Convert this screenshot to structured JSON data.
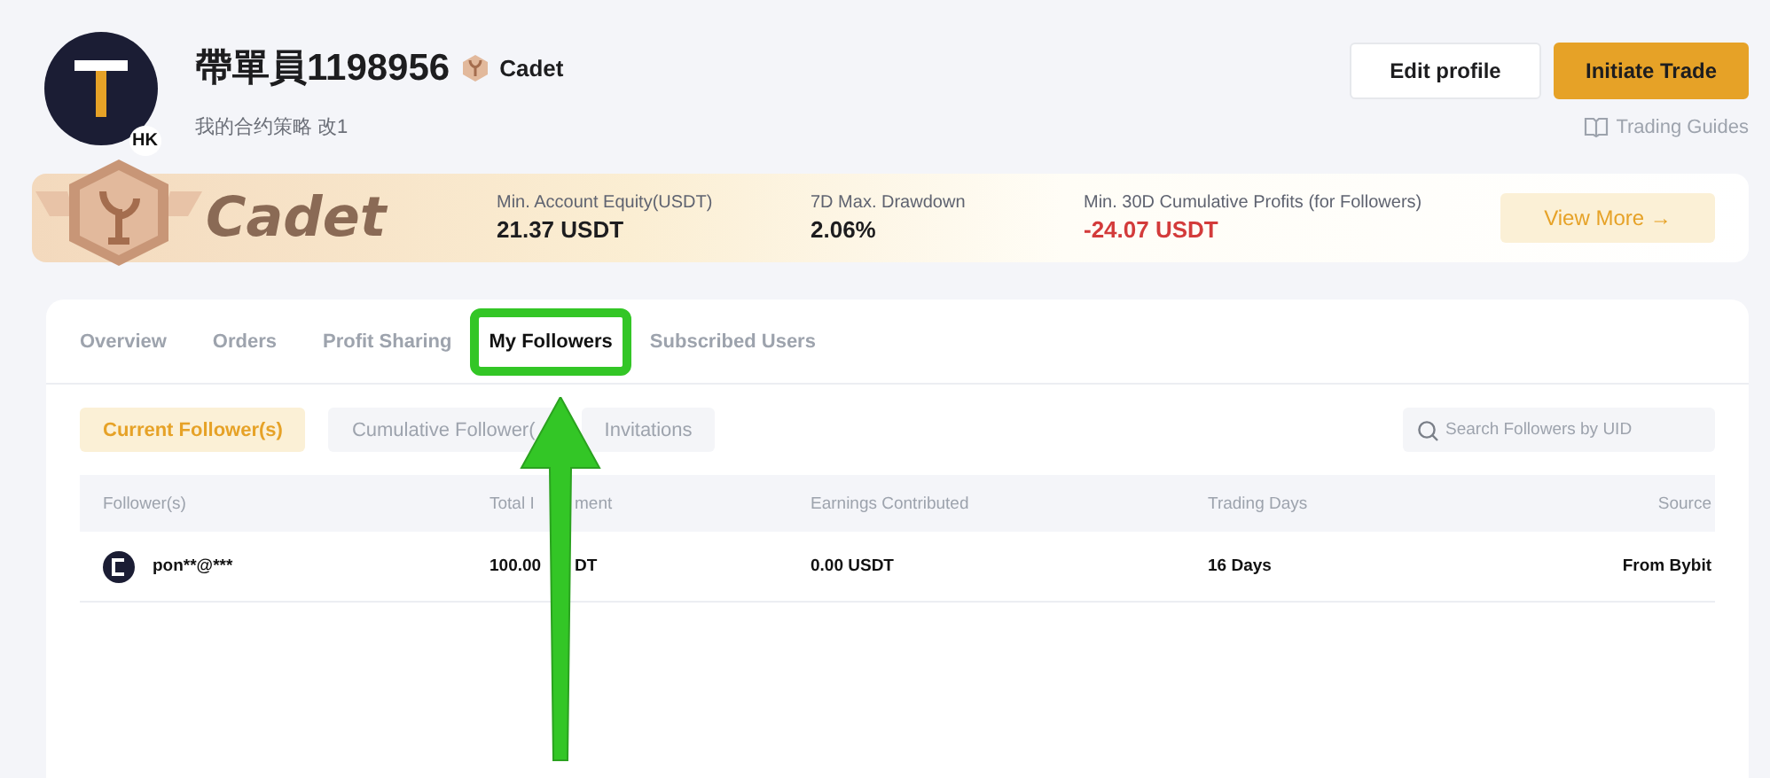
{
  "profile": {
    "avatar_badge": "HK",
    "name": "帶單員1198956",
    "level_badge": "Cadet",
    "bio": "我的合约策略 改1"
  },
  "actions": {
    "edit": "Edit profile",
    "trade": "Initiate Trade",
    "guides": "Trading Guides"
  },
  "banner": {
    "level": "Cadet",
    "stats": [
      {
        "label": "Min. Account Equity(USDT)",
        "value": "21.37 USDT",
        "negative": false
      },
      {
        "label": "7D Max. Drawdown",
        "value": "2.06%",
        "negative": false
      },
      {
        "label": "Min. 30D Cumulative Profits (for Followers)",
        "value": "-24.07 USDT",
        "negative": true
      }
    ],
    "button": "View More",
    "button_icon": "→"
  },
  "tabs": [
    {
      "label": "Overview",
      "selected": false,
      "highlighted": false
    },
    {
      "label": "Orders",
      "selected": false,
      "highlighted": false
    },
    {
      "label": "Profit Sharing",
      "selected": false,
      "highlighted": false
    },
    {
      "label": "My Followers",
      "selected": true,
      "highlighted": true
    },
    {
      "label": "Subscribed Users",
      "selected": false,
      "highlighted": false
    }
  ],
  "subtabs": [
    {
      "label": "Current Follower(s)",
      "selected": true
    },
    {
      "label": "Cumulative Follower(",
      "selected": false
    },
    {
      "label": "Invitations",
      "selected": false
    }
  ],
  "search": {
    "placeholder": "Search Followers by UID"
  },
  "table": {
    "columns": [
      {
        "text": "Follower(s)"
      },
      {
        "text": "Total I",
        "text_after_arrow": "ment"
      },
      {
        "text": "Earnings Contributed"
      },
      {
        "text": "Trading Days"
      },
      {
        "text": "Source"
      }
    ],
    "rows": [
      {
        "cells": [
          {
            "text": "pon**@***"
          },
          {
            "text": "100.00",
            "text_after_arrow": "DT"
          },
          {
            "text": "0.00 USDT"
          },
          {
            "text": "16 Days"
          },
          {
            "text": "From Bybit"
          }
        ]
      }
    ]
  },
  "annotation": {
    "arrow": true
  }
}
